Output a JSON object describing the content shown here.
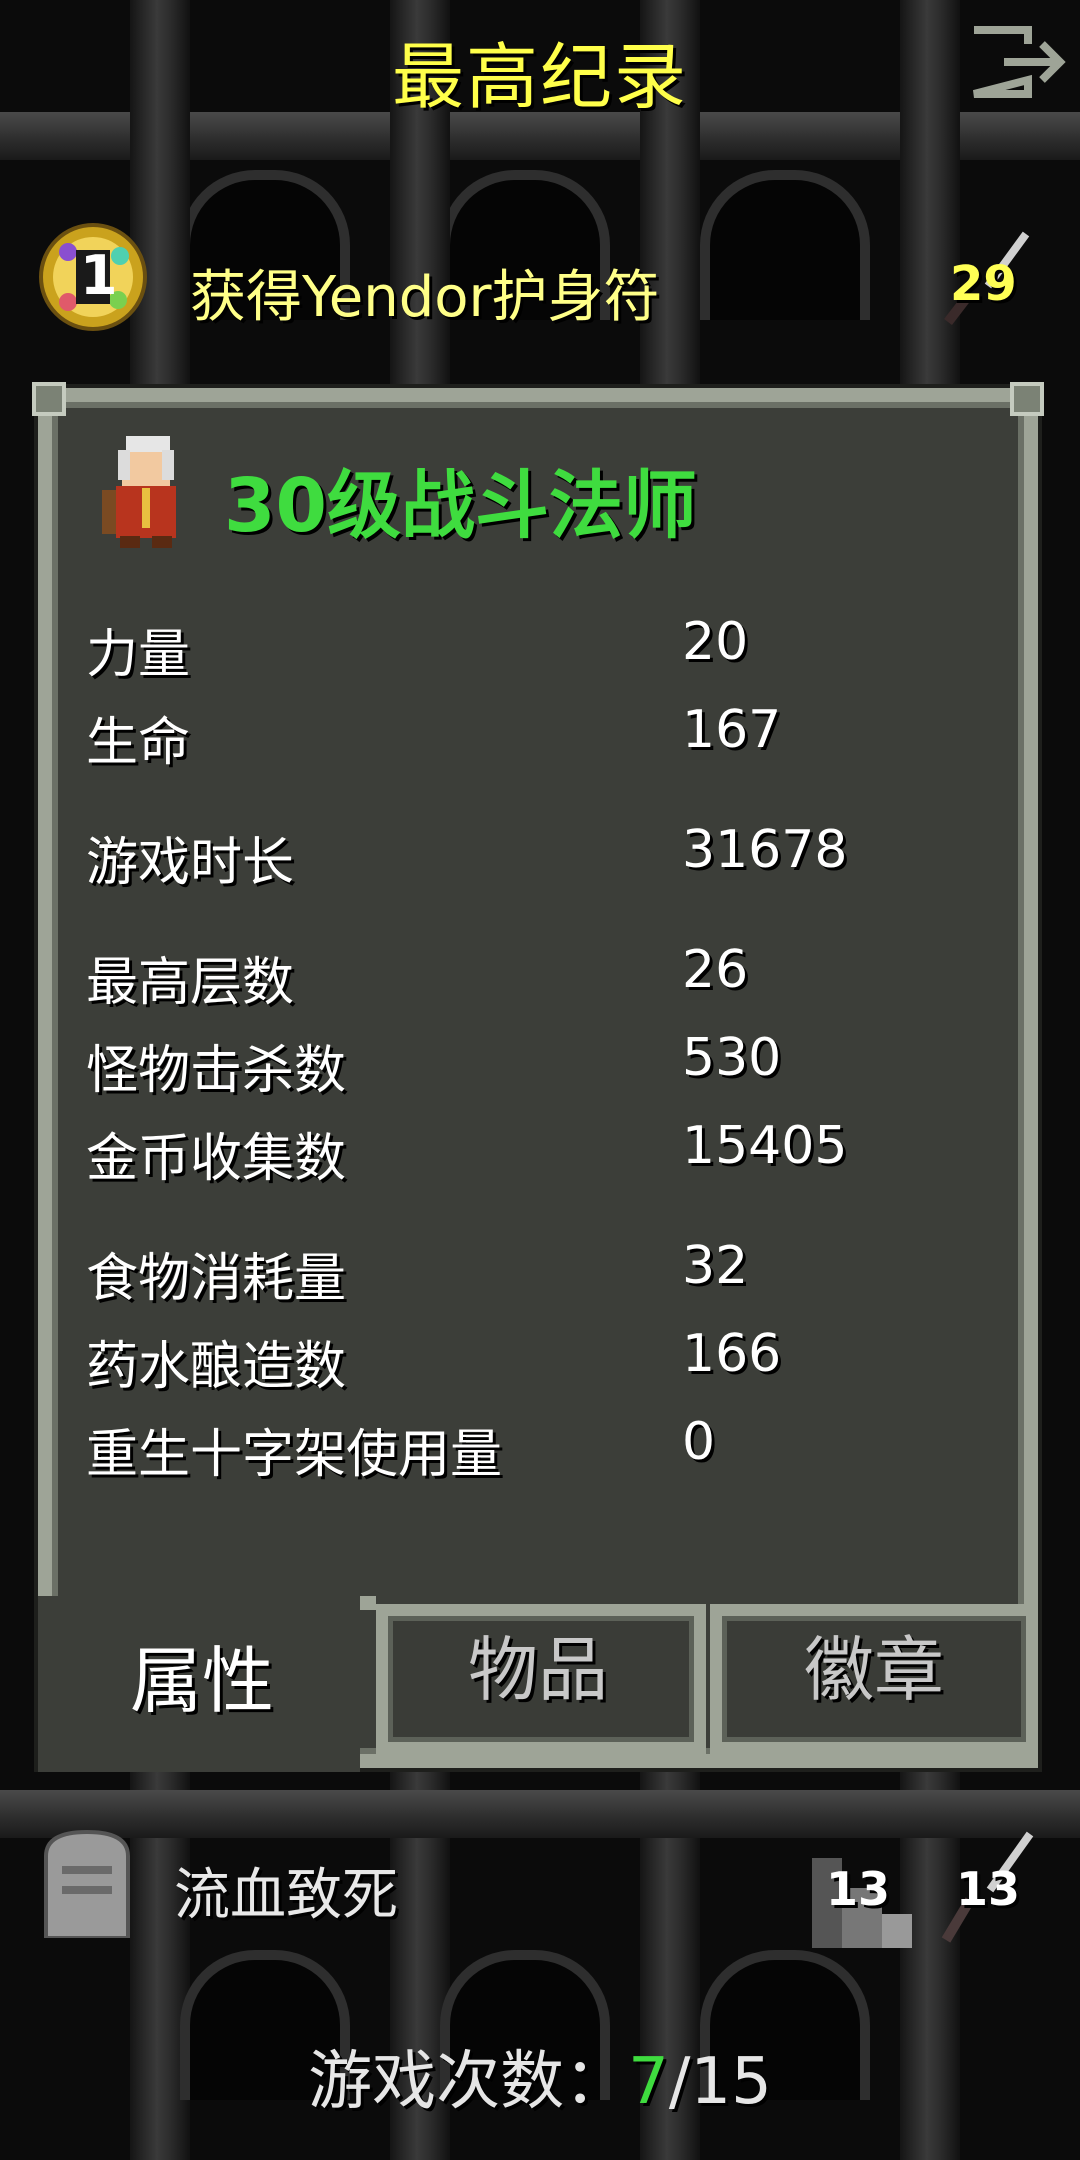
{
  "header": {
    "title": "最高纪录",
    "exit_icon": "exit-icon"
  },
  "record": {
    "rank": "1",
    "title": "获得Yendor护身符",
    "level": "29",
    "badge_icon": "gold-rank-badge-icon",
    "weapon_icon": "sword-icon"
  },
  "hero": {
    "title": "30级战斗法师",
    "portrait_icon": "battlemage-portrait-icon",
    "title_color": "#3fdc3f"
  },
  "stats": [
    {
      "label": "力量",
      "value": "20"
    },
    {
      "label": "生命",
      "value": "167"
    },
    {
      "label": "游戏时长",
      "value": "31678"
    },
    {
      "label": "最高层数",
      "value": "26"
    },
    {
      "label": "怪物击杀数",
      "value": "530"
    },
    {
      "label": "金币收集数",
      "value": "15405"
    },
    {
      "label": "食物消耗量",
      "value": "32"
    },
    {
      "label": "药水酿造数",
      "value": "166"
    },
    {
      "label": "重生十字架使用量",
      "value": "0"
    }
  ],
  "tabs": [
    {
      "label": "属性",
      "active": true
    },
    {
      "label": "物品",
      "active": false
    },
    {
      "label": "徽章",
      "active": false
    }
  ],
  "second_record": {
    "icon": "tombstone-icon",
    "title": "流血致死",
    "depth": "13",
    "level": "13"
  },
  "footer": {
    "prefix": "游戏次数：",
    "current": "7",
    "total": "/15"
  },
  "colors": {
    "title_yellow": "#ffff4a",
    "panel_bg": "#3c3e39",
    "panel_border": "#9ea497",
    "accent_green": "#3fdc3f"
  }
}
